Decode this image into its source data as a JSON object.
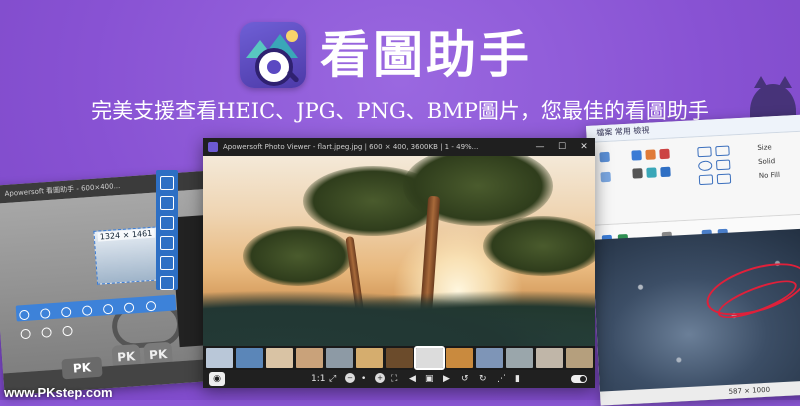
{
  "header": {
    "title": "看圖助手",
    "subtitle": "完美支援查看HEIC、JPG、PNG、BMP圖片，您最佳的看圖助手",
    "icon": "image-viewer-app-icon"
  },
  "viewer_window": {
    "title": "Apowersoft Photo Viewer - flart.jpeg.jpg | 600 × 400, 3600KB | 1 - 49%...",
    "controls": [
      "—",
      "☐",
      "✕"
    ],
    "thumbnail_colors": [
      "#b9c7d8",
      "#5b86b8",
      "#d9c3a4",
      "#c9a27a",
      "#8d9aa5",
      "#d5ad6e",
      "#6b4b2b",
      "#dcdcdc",
      "#c98a3e",
      "#7e95b7",
      "#9aa6ab",
      "#c0b6a8",
      "#b59f7d"
    ],
    "selected_thumbnail": 7,
    "toolbar": {
      "ratio_label": "1:1",
      "icons": [
        "camera-icon",
        "ratio-icon",
        "zoom-in-icon",
        "zoom-out-icon",
        "fullscreen-icon",
        "prev-icon",
        "slideshow-icon",
        "next-icon",
        "rotate-left-icon",
        "rotate-right-icon",
        "share-icon",
        "delete-icon",
        "theme-toggle-icon"
      ]
    }
  },
  "left_window": {
    "title": "Apowersoft 看圖助手 - 600×400...",
    "coords": "1324 × 1461"
  },
  "right_window": {
    "tabs": "檔案   常用   檢視",
    "ribbon_labels": [
      "Size",
      "Solid",
      "No Fill"
    ],
    "status": "587 × 1000"
  },
  "watermark": "www.PKstep.com",
  "pk_badge": "PK"
}
